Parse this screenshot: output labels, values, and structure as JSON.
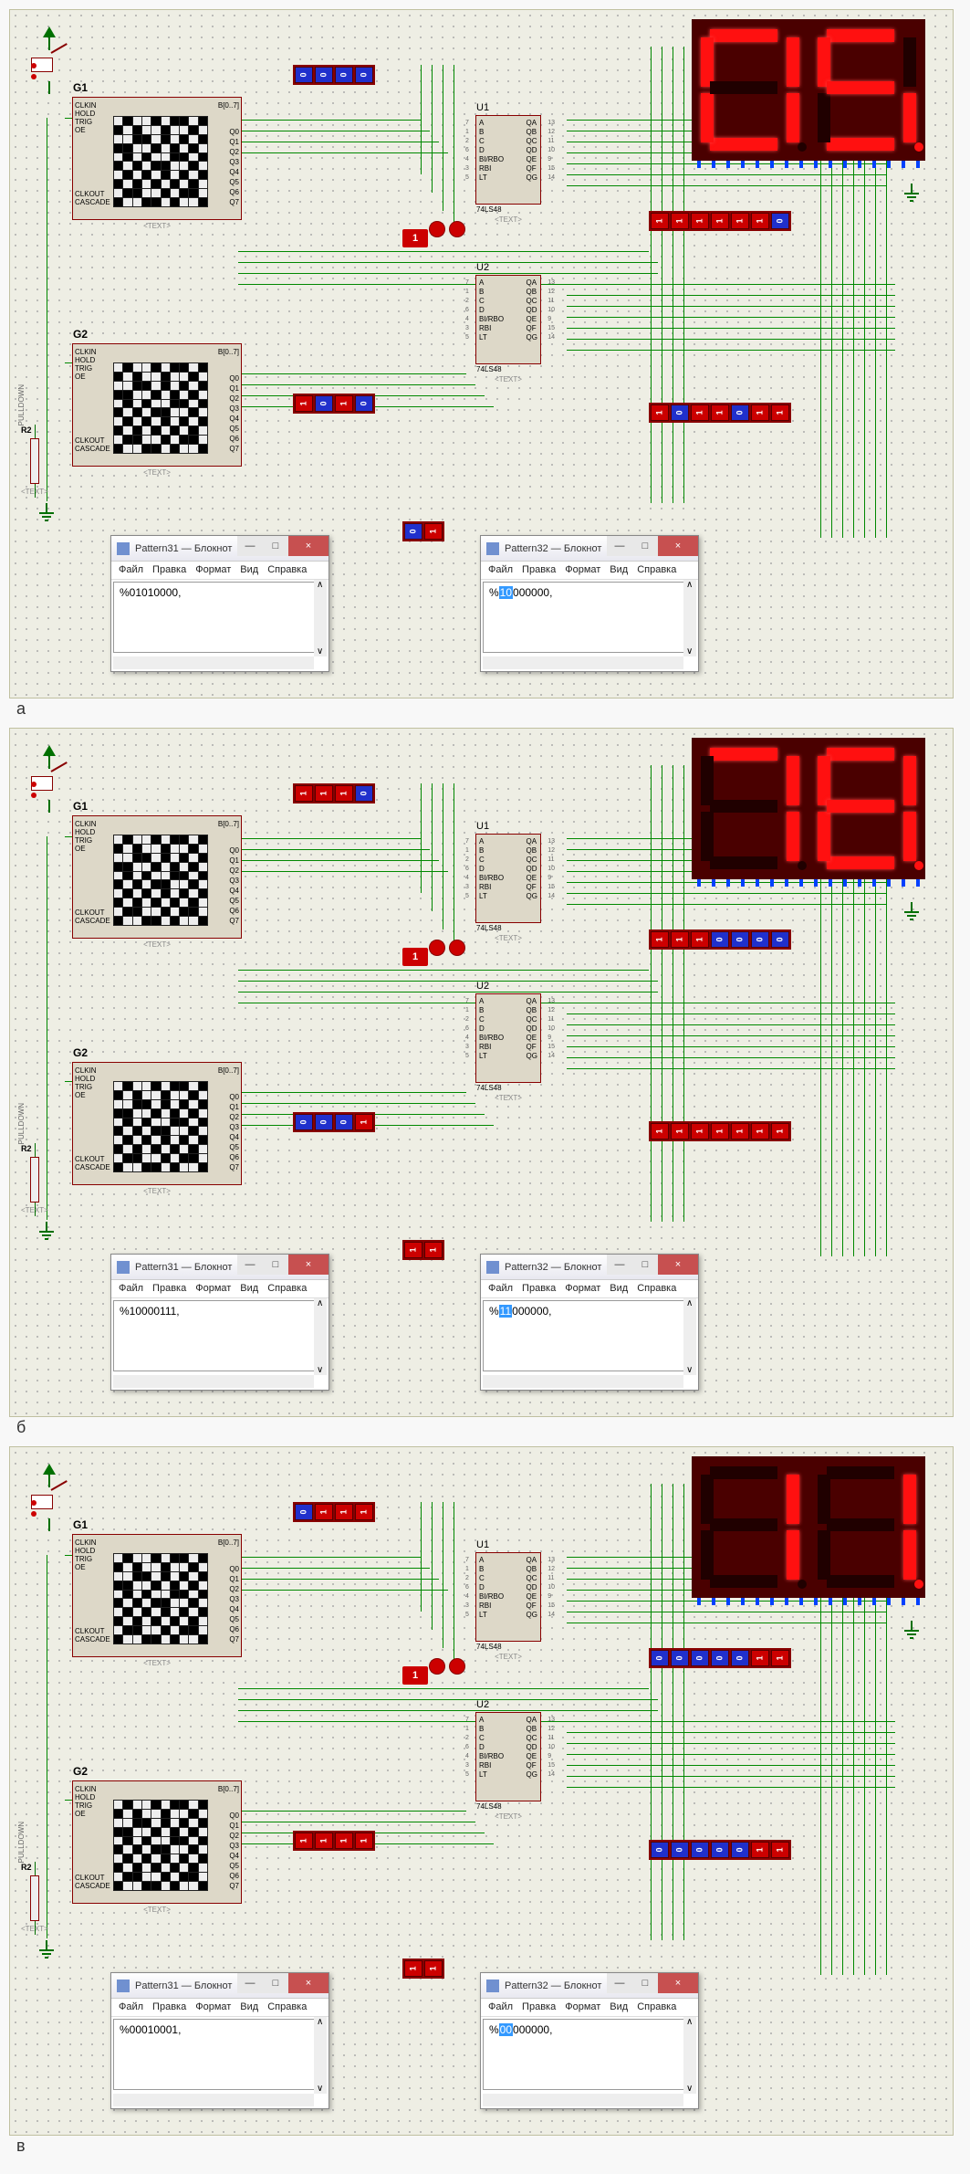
{
  "panels": [
    {
      "label": "а",
      "display": {
        "d1": "0",
        "d2": "5",
        "dp": 2,
        "segs1": [
          1,
          1,
          1,
          1,
          1,
          1,
          0
        ],
        "segs2": [
          1,
          0,
          1,
          1,
          0,
          1,
          1
        ]
      },
      "g1": {
        "name": "G1",
        "bout": "B[0..7]",
        "q": [
          "Q0",
          "Q1",
          "Q2",
          "Q3",
          "Q4",
          "Q5",
          "Q6",
          "Q7"
        ],
        "pinsL_top": [
          "CLKIN",
          "HOLD",
          "TRIG",
          "OE"
        ],
        "pinsL_bot": [
          "CLKOUT",
          "CASCADE"
        ],
        "text": "<TEXT>"
      },
      "g2": {
        "name": "G2",
        "bout": "B[0..7]",
        "q": [
          "Q0",
          "Q1",
          "Q2",
          "Q3",
          "Q4",
          "Q5",
          "Q6",
          "Q7"
        ],
        "pinsL_top": [
          "CLKIN",
          "HOLD",
          "TRIG",
          "OE"
        ],
        "pinsL_bot": [
          "CLKOUT",
          "CASCADE"
        ],
        "text": "<TEXT>"
      },
      "u1": {
        "name": "U1",
        "left": [
          "A",
          "B",
          "C",
          "D",
          "BI/RBO",
          "RBI",
          "LT"
        ],
        "right": [
          "QA",
          "QB",
          "QC",
          "QD",
          "QE",
          "QF",
          "QG"
        ],
        "pinsL": [
          "7",
          "1",
          "2",
          "6",
          "4",
          "3",
          "5"
        ],
        "pinsR": [
          "13",
          "12",
          "11",
          "10",
          "9",
          "15",
          "14"
        ],
        "part": "74LS48",
        "text": "<TEXT>"
      },
      "u2": {
        "name": "U2",
        "left": [
          "A",
          "B",
          "C",
          "D",
          "BI/RBO",
          "RBI",
          "LT"
        ],
        "right": [
          "QA",
          "QB",
          "QC",
          "QD",
          "QE",
          "QF",
          "QG"
        ],
        "pinsL": [
          "7",
          "1",
          "2",
          "6",
          "4",
          "3",
          "5"
        ],
        "pinsR": [
          "13",
          "12",
          "11",
          "10",
          "9",
          "15",
          "14"
        ],
        "part": "74LS48",
        "text": "<TEXT>"
      },
      "logicstate": "1",
      "bank_top": [
        0,
        0,
        0,
        0
      ],
      "bank_mid": [
        1,
        0,
        1,
        0
      ],
      "bank_u1out": [
        1,
        1,
        1,
        1,
        1,
        1,
        0
      ],
      "bank_u2out": [
        1,
        0,
        1,
        1,
        0,
        1,
        1
      ],
      "bank_bottom": [
        0,
        1
      ],
      "resistor": {
        "name": "R2",
        "label": "PULLDOWN",
        "text": "<TEXT>"
      },
      "notepad1": {
        "title": "Pattern31 — Блокнот",
        "menu": [
          "Файл",
          "Правка",
          "Формат",
          "Вид",
          "Справка"
        ],
        "content_prefix": "%",
        "content_sel": "",
        "content_rest": "01010000,"
      },
      "notepad2": {
        "title": "Pattern32 — Блокнот",
        "menu": [
          "Файл",
          "Правка",
          "Формат",
          "Вид",
          "Справка"
        ],
        "content_prefix": "%",
        "content_sel": "10",
        "content_rest": "000000,"
      }
    },
    {
      "label": "б",
      "display": {
        "d1": "7",
        "d2": "8",
        "dp": 2,
        "segs1": [
          1,
          1,
          1,
          0,
          0,
          0,
          0
        ],
        "segs2": [
          1,
          1,
          1,
          1,
          1,
          1,
          1
        ]
      },
      "g1": {
        "name": "G1",
        "bout": "B[0..7]",
        "q": [
          "Q0",
          "Q1",
          "Q2",
          "Q3",
          "Q4",
          "Q5",
          "Q6",
          "Q7"
        ],
        "pinsL_top": [
          "CLKIN",
          "HOLD",
          "TRIG",
          "OE"
        ],
        "pinsL_bot": [
          "CLKOUT",
          "CASCADE"
        ],
        "text": "<TEXT>"
      },
      "g2": {
        "name": "G2",
        "bout": "B[0..7]",
        "q": [
          "Q0",
          "Q1",
          "Q2",
          "Q3",
          "Q4",
          "Q5",
          "Q6",
          "Q7"
        ],
        "pinsL_top": [
          "CLKIN",
          "HOLD",
          "TRIG",
          "OE"
        ],
        "pinsL_bot": [
          "CLKOUT",
          "CASCADE"
        ],
        "text": "<TEXT>"
      },
      "u1": {
        "name": "U1",
        "left": [
          "A",
          "B",
          "C",
          "D",
          "BI/RBO",
          "RBI",
          "LT"
        ],
        "right": [
          "QA",
          "QB",
          "QC",
          "QD",
          "QE",
          "QF",
          "QG"
        ],
        "pinsL": [
          "7",
          "1",
          "2",
          "6",
          "4",
          "3",
          "5"
        ],
        "pinsR": [
          "13",
          "12",
          "11",
          "10",
          "9",
          "15",
          "14"
        ],
        "part": "74LS48",
        "text": "<TEXT>"
      },
      "u2": {
        "name": "U2",
        "left": [
          "A",
          "B",
          "C",
          "D",
          "BI/RBO",
          "RBI",
          "LT"
        ],
        "right": [
          "QA",
          "QB",
          "QC",
          "QD",
          "QE",
          "QF",
          "QG"
        ],
        "pinsL": [
          "7",
          "1",
          "2",
          "6",
          "4",
          "3",
          "5"
        ],
        "pinsR": [
          "13",
          "12",
          "11",
          "10",
          "9",
          "15",
          "14"
        ],
        "part": "74LS48",
        "text": "<TEXT>"
      },
      "logicstate": "1",
      "bank_top": [
        1,
        1,
        1,
        0
      ],
      "bank_mid": [
        0,
        0,
        0,
        1
      ],
      "bank_u1out": [
        1,
        1,
        1,
        0,
        0,
        0,
        0
      ],
      "bank_u2out": [
        1,
        1,
        1,
        1,
        1,
        1,
        1
      ],
      "bank_bottom": [
        1,
        1
      ],
      "resistor": {
        "name": "R2",
        "label": "PULLDOWN",
        "text": "<TEXT>"
      },
      "notepad1": {
        "title": "Pattern31 — Блокнот",
        "menu": [
          "Файл",
          "Правка",
          "Формат",
          "Вид",
          "Справка"
        ],
        "content_prefix": "%",
        "content_sel": "",
        "content_rest": "10000111,"
      },
      "notepad2": {
        "title": "Pattern32 — Блокнот",
        "menu": [
          "Файл",
          "Правка",
          "Формат",
          "Вид",
          "Справка"
        ],
        "content_prefix": "%",
        "content_sel": "11",
        "content_rest": "000000,"
      }
    },
    {
      "label": "в",
      "display": {
        "d1": "1",
        "d2": "1",
        "dp": 2,
        "segs1": [
          0,
          1,
          1,
          0,
          0,
          0,
          0
        ],
        "segs2": [
          0,
          1,
          1,
          0,
          0,
          0,
          0
        ]
      },
      "g1": {
        "name": "G1",
        "bout": "B[0..7]",
        "q": [
          "Q0",
          "Q1",
          "Q2",
          "Q3",
          "Q4",
          "Q5",
          "Q6",
          "Q7"
        ],
        "pinsL_top": [
          "CLKIN",
          "HOLD",
          "TRIG",
          "OE"
        ],
        "pinsL_bot": [
          "CLKOUT",
          "CASCADE"
        ],
        "text": "<TEXT>"
      },
      "g2": {
        "name": "G2",
        "bout": "B[0..7]",
        "q": [
          "Q0",
          "Q1",
          "Q2",
          "Q3",
          "Q4",
          "Q5",
          "Q6",
          "Q7"
        ],
        "pinsL_top": [
          "CLKIN",
          "HOLD",
          "TRIG",
          "OE"
        ],
        "pinsL_bot": [
          "CLKOUT",
          "CASCADE"
        ],
        "text": "<TEXT>"
      },
      "u1": {
        "name": "U1",
        "left": [
          "A",
          "B",
          "C",
          "D",
          "BI/RBO",
          "RBI",
          "LT"
        ],
        "right": [
          "QA",
          "QB",
          "QC",
          "QD",
          "QE",
          "QF",
          "QG"
        ],
        "pinsL": [
          "7",
          "1",
          "2",
          "6",
          "4",
          "3",
          "5"
        ],
        "pinsR": [
          "13",
          "12",
          "11",
          "10",
          "9",
          "15",
          "14"
        ],
        "part": "74LS48",
        "text": "<TEXT>"
      },
      "u2": {
        "name": "U2",
        "left": [
          "A",
          "B",
          "C",
          "D",
          "BI/RBO",
          "RBI",
          "LT"
        ],
        "right": [
          "QA",
          "QB",
          "QC",
          "QD",
          "QE",
          "QF",
          "QG"
        ],
        "pinsL": [
          "7",
          "1",
          "2",
          "6",
          "4",
          "3",
          "5"
        ],
        "pinsR": [
          "13",
          "12",
          "11",
          "10",
          "9",
          "15",
          "14"
        ],
        "part": "74LS48",
        "text": "<TEXT>"
      },
      "logicstate": "1",
      "bank_top": [
        0,
        1,
        1,
        1
      ],
      "bank_mid": [
        1,
        1,
        1,
        1
      ],
      "bank_u1out": [
        0,
        0,
        0,
        0,
        0,
        1,
        1
      ],
      "bank_u2out": [
        0,
        0,
        0,
        0,
        0,
        1,
        1
      ],
      "bank_bottom": [
        1,
        1
      ],
      "resistor": {
        "name": "R2",
        "label": "PULLDOWN",
        "text": "<TEXT>"
      },
      "notepad1": {
        "title": "Pattern31 — Блокнот",
        "menu": [
          "Файл",
          "Правка",
          "Формат",
          "Вид",
          "Справка"
        ],
        "content_prefix": "%",
        "content_sel": "",
        "content_rest": "00010001,"
      },
      "notepad2": {
        "title": "Pattern32 — Блокнот",
        "menu": [
          "Файл",
          "Правка",
          "Формат",
          "Вид",
          "Справка"
        ],
        "content_prefix": "%",
        "content_sel": "00",
        "content_rest": "000000,"
      }
    }
  ]
}
